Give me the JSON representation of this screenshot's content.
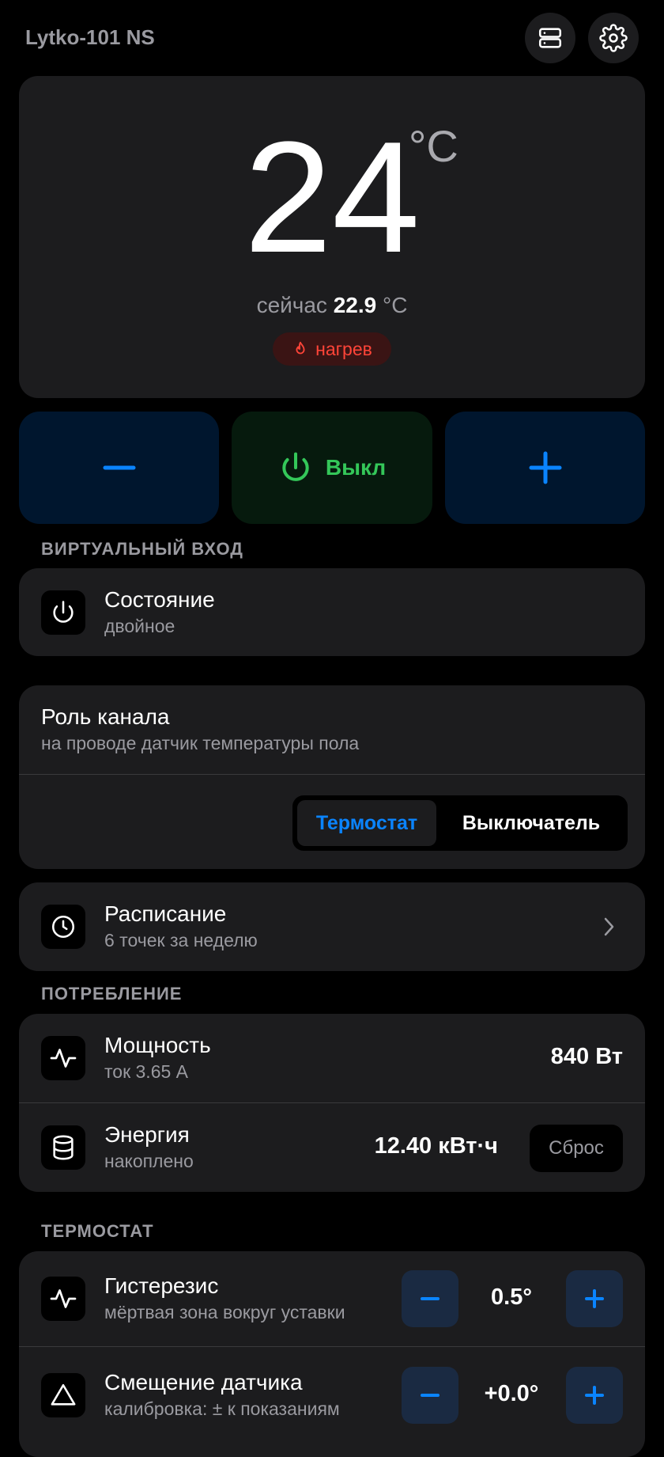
{
  "header": {
    "title": "Lytko-101 NS",
    "devices_icon": "server-icon",
    "settings_icon": "gear-icon"
  },
  "thermostat": {
    "setpoint": "24",
    "unit": "°C",
    "current_prefix": "сейчас",
    "current_value": "22.9",
    "current_unit": "°C",
    "status_label": "нагрев",
    "status_icon": "flame-icon",
    "status_color": "#ff4438"
  },
  "controls": {
    "decrease_icon": "minus-icon",
    "power_label": "Выкл",
    "power_icon": "power-icon",
    "increase_icon": "plus-icon",
    "accent": "#0a84ff",
    "power_color": "#34c759"
  },
  "virtual_input": {
    "section_title": "ВИРТУАЛЬНЫЙ ВХОД",
    "state_title": "Состояние",
    "state_value": "двойное"
  },
  "channel_role": {
    "title": "Роль канала",
    "subtitle": "на проводе датчик температуры пола",
    "options": [
      "Термостат",
      "Выключатель"
    ],
    "selected": "Термостат"
  },
  "schedule": {
    "title": "Расписание",
    "subtitle": "6 точек за неделю"
  },
  "consumption": {
    "section_title": "ПОТРЕБЛЕНИЕ",
    "power_title": "Мощность",
    "power_sub": "ток 3.65 А",
    "power_value": "840 Вт",
    "energy_title": "Энергия",
    "energy_sub": "накоплено",
    "energy_value": "12.40 кВт·ч",
    "reset_label": "Сброс"
  },
  "thermostat_settings": {
    "section_title": "ТЕРМОСТАТ",
    "hysteresis_title": "Гистерезис",
    "hysteresis_sub": "мёртвая зона вокруг уставки",
    "hysteresis_value": "0.5°",
    "offset_title": "Смещение датчика",
    "offset_sub": "калибровка: ± к показаниям",
    "offset_value": "+0.0°"
  }
}
